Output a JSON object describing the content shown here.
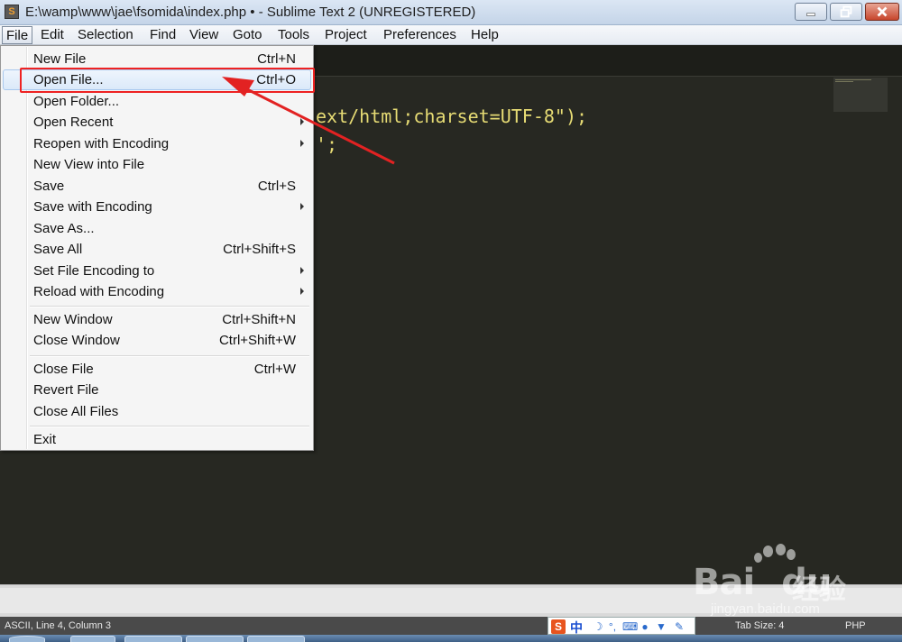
{
  "window": {
    "title": "E:\\wamp\\www\\jae\\fsomida\\index.php • - Sublime Text 2 (UNREGISTERED)",
    "app_icon": "S"
  },
  "menubar": {
    "items": [
      "File",
      "Edit",
      "Selection",
      "Find",
      "View",
      "Goto",
      "Tools",
      "Project",
      "Preferences",
      "Help"
    ],
    "active": "File"
  },
  "editor": {
    "line1": "ext/html;charset=UTF-8\");",
    "line2": "';"
  },
  "file_menu": {
    "groups": [
      [
        {
          "label": "New File",
          "shortcut": "Ctrl+N"
        },
        {
          "label": "Open File...",
          "shortcut": "Ctrl+O",
          "highlighted": true
        },
        {
          "label": "Open Folder...",
          "shortcut": ""
        },
        {
          "label": "Open Recent",
          "shortcut": "",
          "submenu": true
        },
        {
          "label": "Reopen with Encoding",
          "shortcut": "",
          "submenu": true
        },
        {
          "label": "New View into File",
          "shortcut": ""
        },
        {
          "label": "Save",
          "shortcut": "Ctrl+S"
        },
        {
          "label": "Save with Encoding",
          "shortcut": "",
          "submenu": true
        },
        {
          "label": "Save As...",
          "shortcut": ""
        },
        {
          "label": "Save All",
          "shortcut": "Ctrl+Shift+S"
        },
        {
          "label": "Set File Encoding to",
          "shortcut": "",
          "submenu": true
        },
        {
          "label": "Reload with Encoding",
          "shortcut": "",
          "submenu": true
        }
      ],
      [
        {
          "label": "New Window",
          "shortcut": "Ctrl+Shift+N"
        },
        {
          "label": "Close Window",
          "shortcut": "Ctrl+Shift+W"
        }
      ],
      [
        {
          "label": "Close File",
          "shortcut": "Ctrl+W"
        },
        {
          "label": "Revert File",
          "shortcut": ""
        },
        {
          "label": "Close All Files",
          "shortcut": ""
        }
      ],
      [
        {
          "label": "Exit",
          "shortcut": ""
        }
      ]
    ]
  },
  "statusbar": {
    "position": "ASCII, Line 4, Column 3",
    "tab_size": "Tab Size: 4",
    "syntax": "PHP"
  },
  "ime": {
    "logo": "S",
    "mode": "中",
    "icons": [
      "moon-icon",
      "punctuation-icon",
      "keyboard-icon",
      "user-icon",
      "shirt-icon",
      "wrench-icon"
    ]
  },
  "watermark": {
    "brand": "Bai",
    "brand_end": "du",
    "cn": "经验",
    "url": "jingyan.baidu.com"
  },
  "colors": {
    "editor_bg": "#272822",
    "code_string": "#e6db74",
    "annotation_red": "#e22222"
  }
}
